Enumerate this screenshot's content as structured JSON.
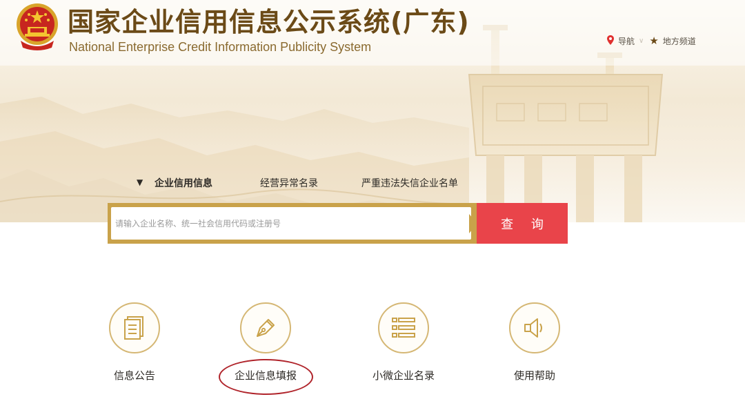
{
  "header": {
    "title_cn": "国家企业信用信息公示系统(广东)",
    "title_en": "National Enterprise Credit Information Publicity System"
  },
  "topnav": {
    "nav_label": "导航",
    "regional_label": "地方频道"
  },
  "search": {
    "tabs": [
      {
        "label": "企业信用信息",
        "active": true
      },
      {
        "label": "经营异常名录",
        "active": false
      },
      {
        "label": "严重违法失信企业名单",
        "active": false
      }
    ],
    "placeholder": "请输入企业名称、统一社会信用代码或注册号",
    "button_label": "查 询"
  },
  "features": [
    {
      "label": "信息公告",
      "icon": "document-icon"
    },
    {
      "label": "企业信息填报",
      "icon": "pen-icon",
      "highlighted": true
    },
    {
      "label": "小微企业名录",
      "icon": "list-icon"
    },
    {
      "label": "使用帮助",
      "icon": "speaker-icon"
    }
  ],
  "colors": {
    "gold": "#c9a24a",
    "brown": "#6b4a17",
    "search_button": "#e9444a",
    "highlight": "#b0242b"
  }
}
